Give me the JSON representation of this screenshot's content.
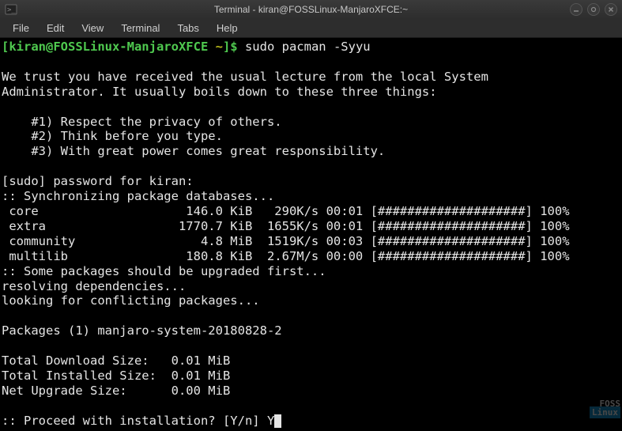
{
  "window": {
    "title": "Terminal - kiran@FOSSLinux-ManjaroXFCE:~"
  },
  "menu": {
    "file": "File",
    "edit": "Edit",
    "view": "View",
    "terminal": "Terminal",
    "tabs": "Tabs",
    "help": "Help"
  },
  "prompt": {
    "user_host": "[kiran@FOSSLinux-ManjaroXFCE",
    "tilde": " ~",
    "bracket_dollar": "]$",
    "command": " sudo pacman -Syyu"
  },
  "lecture": {
    "l1": "We trust you have received the usual lecture from the local System",
    "l2": "Administrator. It usually boils down to these three things:",
    "r1": "    #1) Respect the privacy of others.",
    "r2": "    #2) Think before you type.",
    "r3": "    #3) With great power comes great responsibility."
  },
  "sudo_prompt": "[sudo] password for kiran:",
  "sync_header": ":: Synchronizing package databases...",
  "dl": {
    "core": " core                    146.0 KiB   290K/s 00:01 [####################] 100%",
    "extra": " extra                  1770.7 KiB  1655K/s 00:01 [####################] 100%",
    "community": " community                 4.8 MiB  1519K/s 00:03 [####################] 100%",
    "multilib": " multilib                180.8 KiB  2.67M/s 00:00 [####################] 100%"
  },
  "upgrade_msg": ":: Some packages should be upgraded first...",
  "resolving": "resolving dependencies...",
  "looking": "looking for conflicting packages...",
  "packages": "Packages (1) manjaro-system-20180828-2",
  "sizes": {
    "download": "Total Download Size:   0.01 MiB",
    "installed": "Total Installed Size:  0.01 MiB",
    "net": "Net Upgrade Size:      0.00 MiB"
  },
  "proceed": ":: Proceed with installation? [Y/n] Y",
  "watermark": {
    "foss": "FOSS",
    "linux": "Linux"
  }
}
